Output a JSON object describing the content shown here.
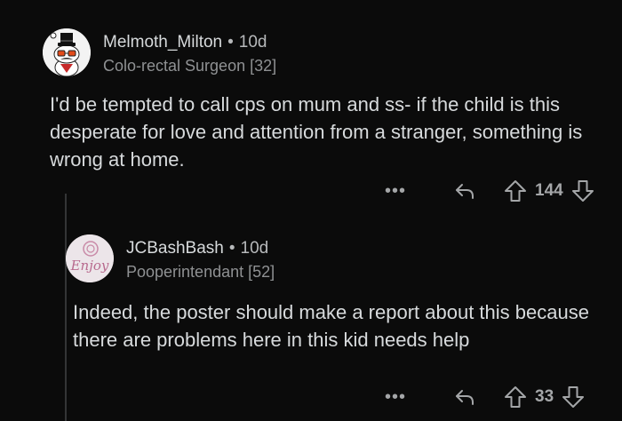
{
  "comments": [
    {
      "username": "Melmoth_Milton",
      "separator": "•",
      "age": "10d",
      "flair": "Colo-rectal Surgeon [32]",
      "body": "I'd be tempted to call cps on mum and ss- if the child is this desperate for love and attention from a stranger, something is wrong at home.",
      "more": "•••",
      "score": "144",
      "avatar_icon": "snoo-top-hat-avatar-icon"
    },
    {
      "username": "JCBashBash",
      "separator": "•",
      "age": "10d",
      "flair": "Pooperintendant [52]",
      "body": "Indeed, the poster should make a report about this because there are problems here in this kid needs help",
      "more": "•••",
      "score": "33",
      "avatar_icon": "enjoy-avatar-icon",
      "avatar_text": "Enjoy"
    }
  ],
  "colors": {
    "background": "#0b0b0b",
    "text": "#d7dadc",
    "muted": "#8f9193",
    "thread_line": "#343536"
  }
}
